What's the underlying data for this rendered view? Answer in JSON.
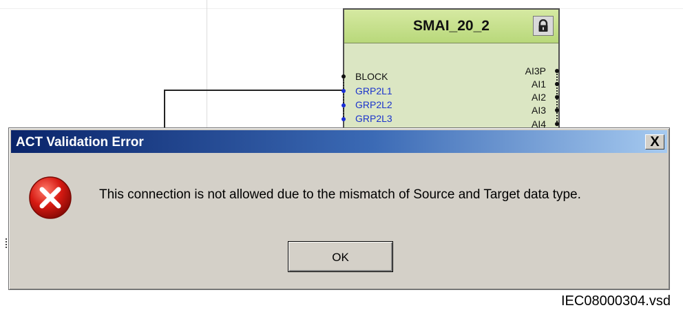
{
  "block": {
    "title": "SMAI_20_2",
    "lock_icon": "lock-icon",
    "inputs": [
      {
        "label": "BLOCK",
        "color": "#111111"
      },
      {
        "label": "GRP2L1",
        "color": "#1a33cc"
      },
      {
        "label": "GRP2L2",
        "color": "#1a33cc"
      },
      {
        "label": "GRP2L3",
        "color": "#1a33cc"
      }
    ],
    "outputs": [
      "AI3P",
      "AI1",
      "AI2",
      "AI3",
      "AI4"
    ]
  },
  "dialog": {
    "title": "ACT Validation Error",
    "close_label": "X",
    "error_icon": "error-icon",
    "message": "This connection is not allowed due to the mismatch of Source and Target data type.",
    "ok_label": "OK"
  },
  "caption": "IEC08000304.vsd",
  "colors": {
    "titlebar_start": "#0a246a",
    "titlebar_end": "#a6caf0",
    "dialog_bg": "#d4d0c8",
    "block_header": "#c4df8c",
    "block_body": "#dbe6c3",
    "error_red": "#cc1111"
  }
}
